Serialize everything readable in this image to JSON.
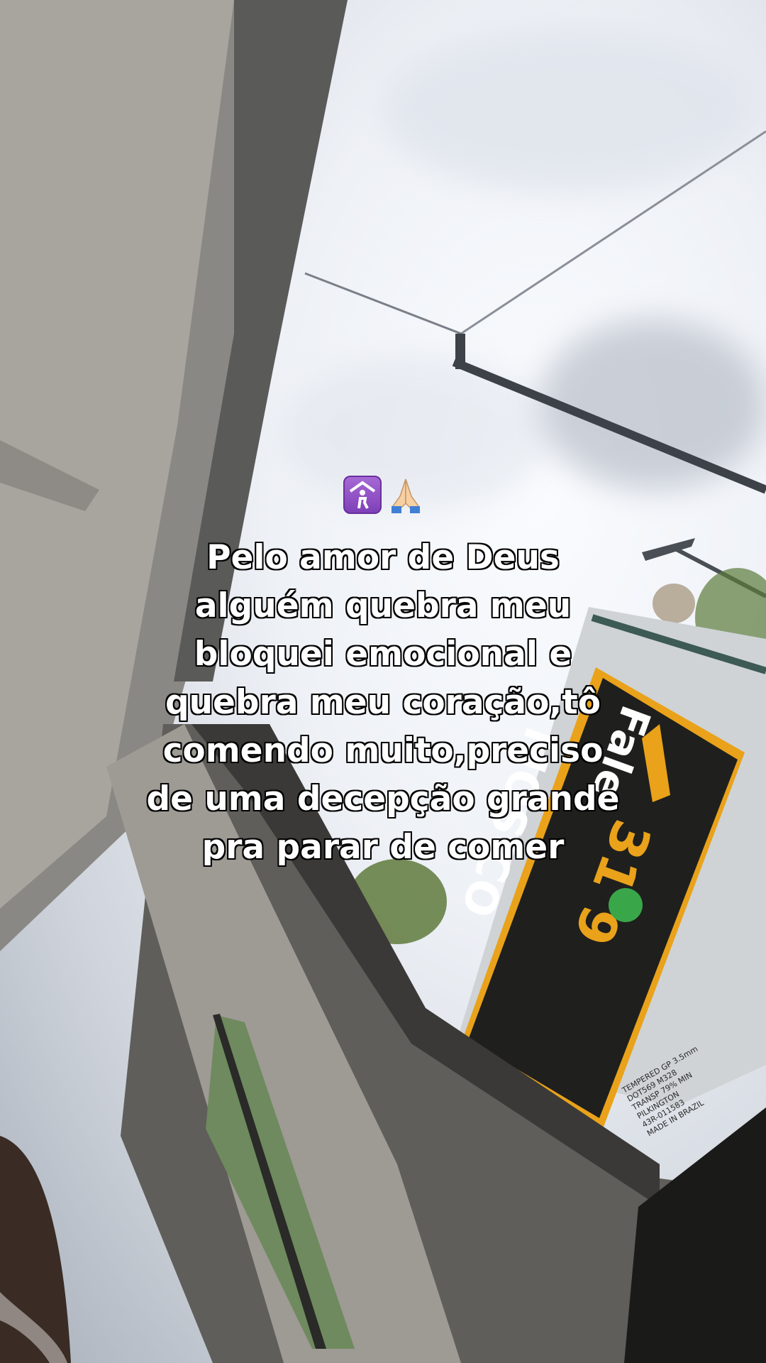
{
  "overlay": {
    "emojis": [
      "worship-symbol-icon",
      "folded-hands-icon"
    ],
    "lines": [
      "Pelo amor de Deus",
      "alguém quebra meu",
      "bloquei emocional e",
      "quebra meu coração,tô",
      "comendo muito,preciso",
      "de uma decepção grande",
      "pra parar de comer"
    ]
  },
  "billboard": {
    "line1": "31 9",
    "line2": "MOS CO",
    "line3": "Fale"
  },
  "window_sticker": {
    "lines": [
      "TEMPERED GP 3.5mm",
      "DOT569 M328",
      "TRANSP 79% MIN",
      "PILKINGTON",
      "43R-011583",
      "MADE IN BRAZIL"
    ]
  },
  "colors": {
    "overlay_text": "#ffffff",
    "text_outline": "#000000",
    "billboard_yellow": "#e9a21a"
  }
}
